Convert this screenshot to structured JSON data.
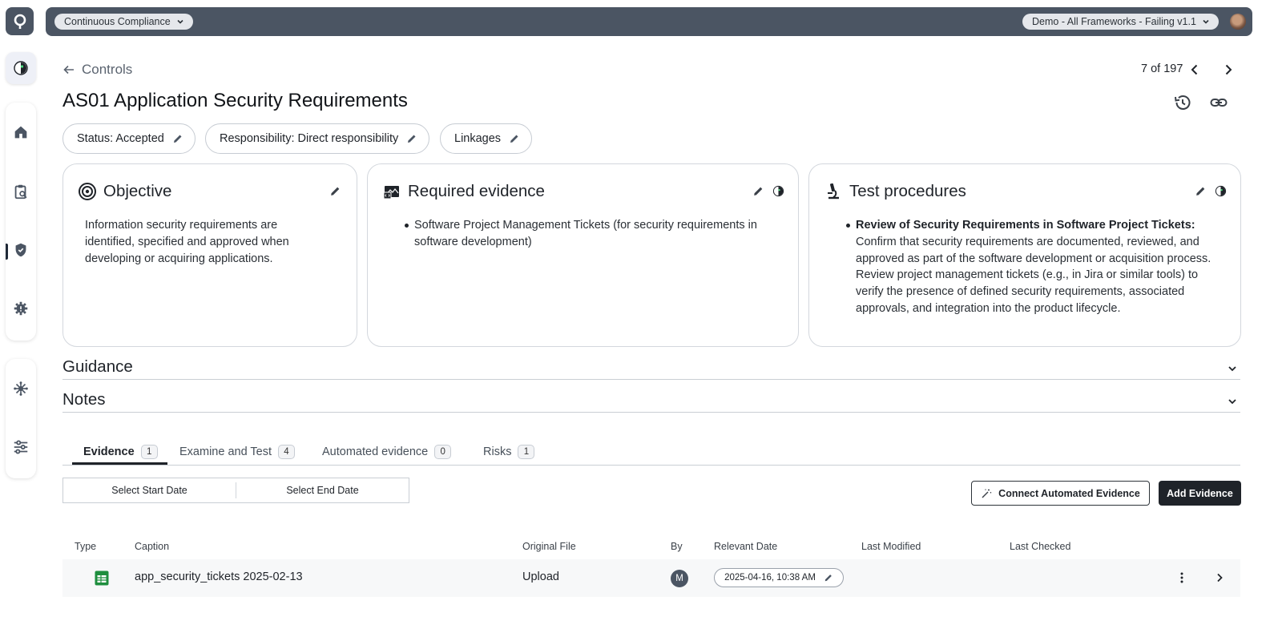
{
  "topbar": {
    "workspace_label": "Continuous Compliance",
    "framework_label": "Demo - All Frameworks - Failing v1.1"
  },
  "rail": {
    "icons": [
      "assistant-icon",
      "home-icon",
      "clipboard-search-icon",
      "shield-icon",
      "alert-gear-icon",
      "integrations-icon",
      "settings-sliders-icon"
    ]
  },
  "header": {
    "back_label": "Controls",
    "pager_text": "7 of 197",
    "title": "AS01 Application Security Requirements"
  },
  "chips": {
    "status": "Status: Accepted",
    "responsibility": "Responsibility: Direct responsibility",
    "linkages": "Linkages"
  },
  "cards": {
    "objective": {
      "title": "Objective",
      "body": "Information security requirements are identified, specified and approved when developing or acquiring applications."
    },
    "required_evidence": {
      "title": "Required evidence",
      "items": [
        "Software Project Management Tickets (for security requirements in software development)"
      ]
    },
    "test_procedures": {
      "title": "Test procedures",
      "item_heading": "Review of Security Requirements in Software Project Tickets:",
      "item_body": "Confirm that security requirements are documented, reviewed, and approved as part of the software development or acquisition process. Review project management tickets (e.g., in Jira or similar tools) to verify the presence of defined security requirements, associated approvals, and integration into the product lifecycle."
    }
  },
  "sections": {
    "guidance": "Guidance",
    "notes": "Notes"
  },
  "tabs": [
    {
      "label": "Evidence",
      "count": "1"
    },
    {
      "label": "Examine and Test",
      "count": "4"
    },
    {
      "label": "Automated evidence",
      "count": "0"
    },
    {
      "label": "Risks",
      "count": "1"
    }
  ],
  "filters": {
    "start_date": "Select Start Date",
    "end_date": "Select End Date",
    "connect_button": "Connect Automated Evidence",
    "add_button": "Add Evidence"
  },
  "table": {
    "columns": [
      "Type",
      "Caption",
      "Original File",
      "By",
      "Relevant Date",
      "Last Modified",
      "Last Checked"
    ],
    "rows": [
      {
        "type_icon": "spreadsheet-icon",
        "caption": "app_security_tickets 2025-02-13",
        "original_file": "Upload",
        "by": "M",
        "relevant_date": "2025-04-16, 10:38 AM",
        "last_modified": "",
        "last_checked": ""
      }
    ]
  },
  "colors": {
    "topbar": "#4b5563",
    "primary_button": "#1f2329",
    "spreadsheet_green": "#1e8e3e"
  }
}
